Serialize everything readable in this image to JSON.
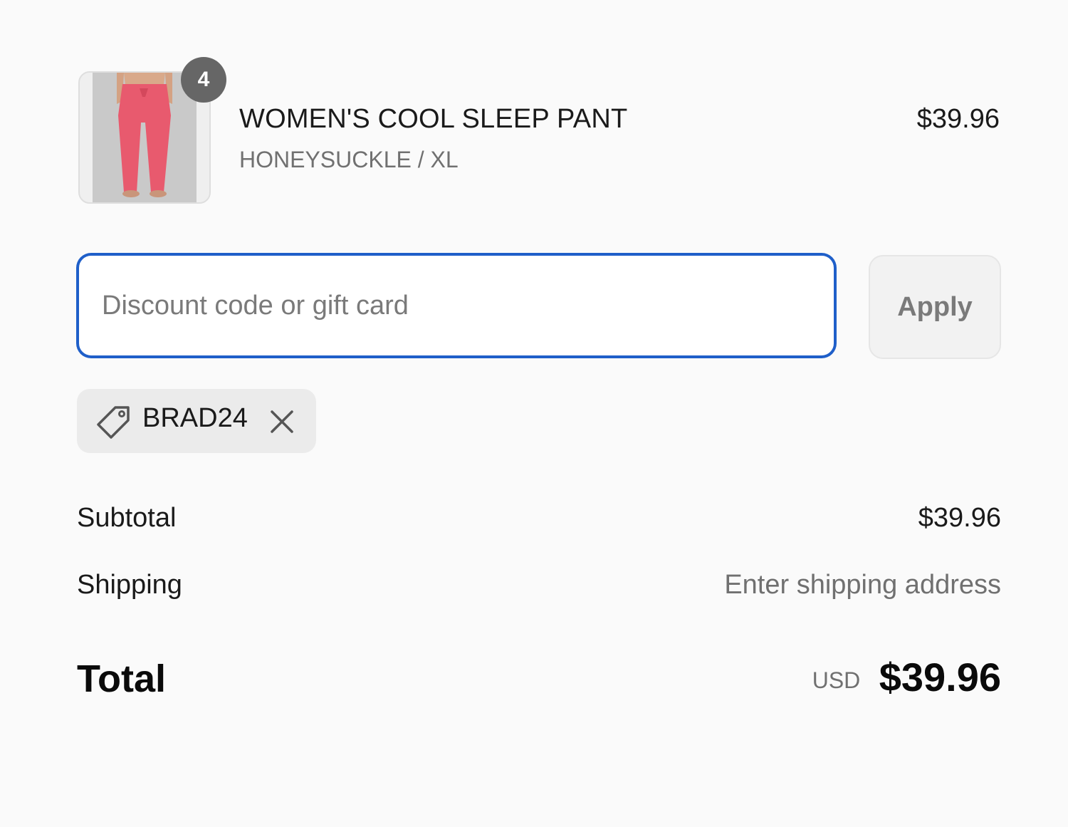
{
  "line_item": {
    "quantity": "4",
    "name": "WOMEN'S COOL SLEEP PANT",
    "variant": "HONEYSUCKLE / XL",
    "price": "$39.96",
    "thumbnail_color": "#e85a6e"
  },
  "discount": {
    "input_placeholder": "Discount code or gift card",
    "input_value": "",
    "apply_label": "Apply",
    "applied_code": "BRAD24",
    "focus_color": "#1f5fc9"
  },
  "summary": {
    "subtotal_label": "Subtotal",
    "subtotal_value": "$39.96",
    "shipping_label": "Shipping",
    "shipping_value": "Enter shipping address",
    "total_label": "Total",
    "currency": "USD",
    "total_value": "$39.96"
  },
  "icons": {
    "tag": "tag-icon",
    "remove": "close-icon"
  }
}
